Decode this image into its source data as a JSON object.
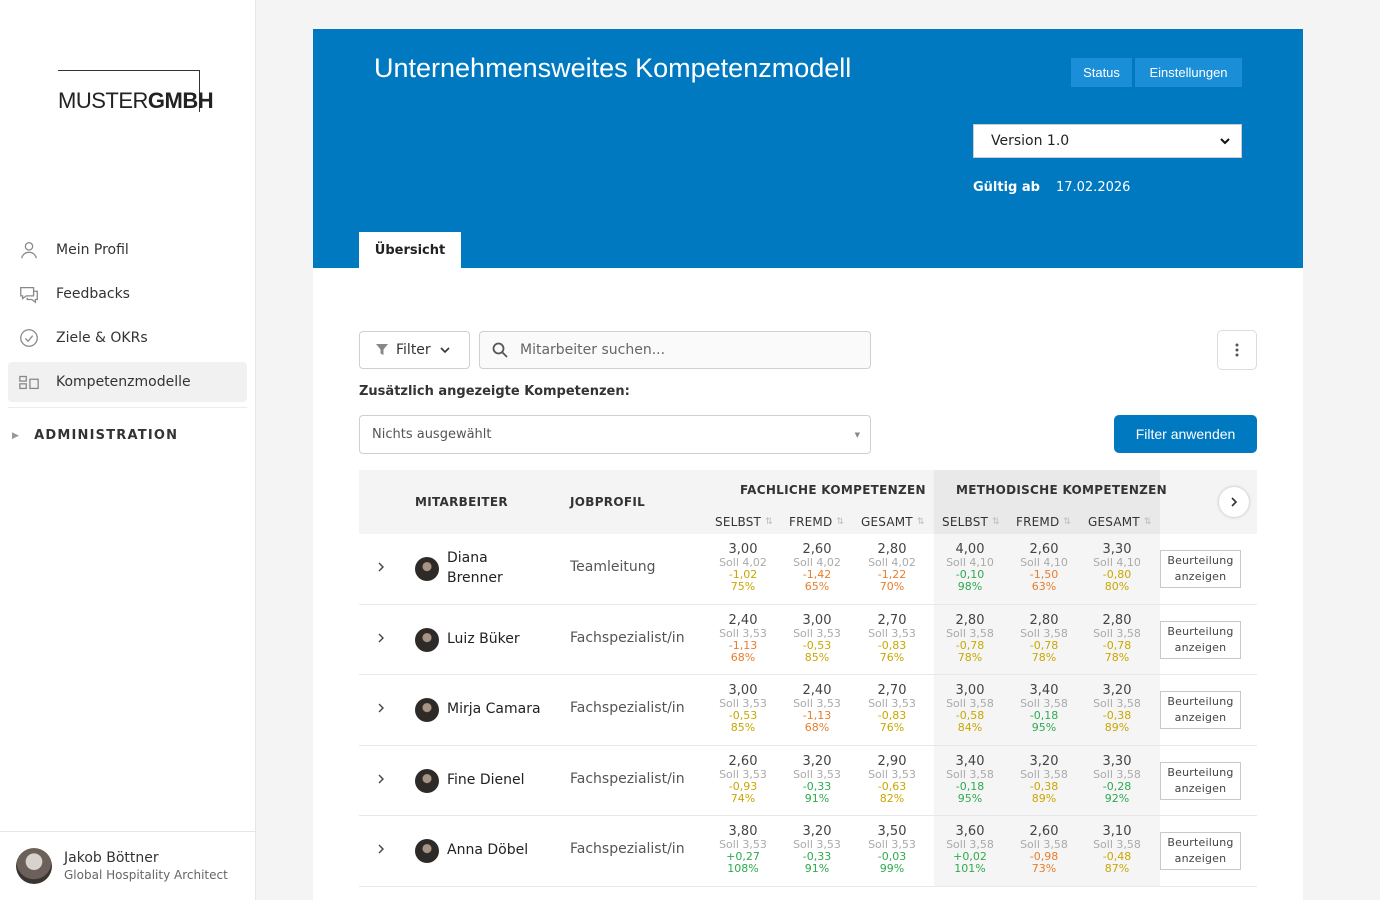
{
  "sidebar": {
    "logo": {
      "part1": "MUSTER",
      "part2": "GMBH"
    },
    "items": [
      {
        "label": "Mein Profil",
        "icon": "user-icon"
      },
      {
        "label": "Feedbacks",
        "icon": "chat-icon"
      },
      {
        "label": "Ziele & OKRs",
        "icon": "check-circle-icon"
      },
      {
        "label": "Kompetenzmodelle",
        "icon": "competence-icon",
        "active": true
      }
    ],
    "admin_label": "ADMINISTRATION",
    "user": {
      "name": "Jakob Böttner",
      "role": "Global Hospitality Architect"
    }
  },
  "header": {
    "title": "Unternehmensweites Kompetenzmodell",
    "status_label": "Status",
    "settings_label": "Einstellungen",
    "version": "Version 1.0",
    "valid_label": "Gültig ab",
    "valid_date": "17.02.2026",
    "tab": "Übersicht",
    "accent_color": "#0079c1"
  },
  "toolbar": {
    "filter_label": "Filter",
    "search_placeholder": "Mitarbeiter suchen...",
    "extra_label": "Zusätzlich angezeigte Kompetenzen:",
    "multiselect_value": "Nichts ausgewählt",
    "apply_label": "Filter anwenden"
  },
  "table": {
    "col_employee": "MITARBEITER",
    "col_job": "JOBPROFIL",
    "group_fach": "FACHLICHE KOMPETENZEN",
    "group_meth": "METHODISCHE KOMPETENZEN",
    "sub": [
      "SELBST",
      "FREMD",
      "GESAMT",
      "SELBST",
      "FREMD",
      "GESAMT"
    ],
    "eval_line1": "Beurteilung",
    "eval_line2": "anzeigen",
    "rows": [
      {
        "name1": "Diana",
        "name2": "Brenner",
        "job": "Teamleitung",
        "cells": [
          {
            "v": "3,00",
            "s": "Soll 4,02",
            "d": "-1,02",
            "p": "75%",
            "c": "neg-mid"
          },
          {
            "v": "2,60",
            "s": "Soll 4,02",
            "d": "-1,42",
            "p": "65%",
            "c": "neg-bad"
          },
          {
            "v": "2,80",
            "s": "Soll 4,02",
            "d": "-1,22",
            "p": "70%",
            "c": "neg-bad"
          },
          {
            "v": "4,00",
            "s": "Soll 4,10",
            "d": "-0,10",
            "p": "98%",
            "c": "pos"
          },
          {
            "v": "2,60",
            "s": "Soll 4,10",
            "d": "-1,50",
            "p": "63%",
            "c": "neg-bad"
          },
          {
            "v": "3,30",
            "s": "Soll 4,10",
            "d": "-0,80",
            "p": "80%",
            "c": "neg-mid"
          }
        ]
      },
      {
        "name1": "Luiz Büker",
        "name2": "",
        "job": "Fachspezialist/in",
        "cells": [
          {
            "v": "2,40",
            "s": "Soll 3,53",
            "d": "-1,13",
            "p": "68%",
            "c": "neg-bad"
          },
          {
            "v": "3,00",
            "s": "Soll 3,53",
            "d": "-0,53",
            "p": "85%",
            "c": "neg-mid"
          },
          {
            "v": "2,70",
            "s": "Soll 3,53",
            "d": "-0,83",
            "p": "76%",
            "c": "neg-mid"
          },
          {
            "v": "2,80",
            "s": "Soll 3,58",
            "d": "-0,78",
            "p": "78%",
            "c": "neg-mid"
          },
          {
            "v": "2,80",
            "s": "Soll 3,58",
            "d": "-0,78",
            "p": "78%",
            "c": "neg-mid"
          },
          {
            "v": "2,80",
            "s": "Soll 3,58",
            "d": "-0,78",
            "p": "78%",
            "c": "neg-mid"
          }
        ]
      },
      {
        "name1": "Mirja Camara",
        "name2": "",
        "job": "Fachspezialist/in",
        "cells": [
          {
            "v": "3,00",
            "s": "Soll 3,53",
            "d": "-0,53",
            "p": "85%",
            "c": "neg-mid"
          },
          {
            "v": "2,40",
            "s": "Soll 3,53",
            "d": "-1,13",
            "p": "68%",
            "c": "neg-bad"
          },
          {
            "v": "2,70",
            "s": "Soll 3,53",
            "d": "-0,83",
            "p": "76%",
            "c": "neg-mid"
          },
          {
            "v": "3,00",
            "s": "Soll 3,58",
            "d": "-0,58",
            "p": "84%",
            "c": "neg-mid"
          },
          {
            "v": "3,40",
            "s": "Soll 3,58",
            "d": "-0,18",
            "p": "95%",
            "c": "pos"
          },
          {
            "v": "3,20",
            "s": "Soll 3,58",
            "d": "-0,38",
            "p": "89%",
            "c": "neg-mid"
          }
        ]
      },
      {
        "name1": "Fine Dienel",
        "name2": "",
        "job": "Fachspezialist/in",
        "cells": [
          {
            "v": "2,60",
            "s": "Soll 3,53",
            "d": "-0,93",
            "p": "74%",
            "c": "neg-mid"
          },
          {
            "v": "3,20",
            "s": "Soll 3,53",
            "d": "-0,33",
            "p": "91%",
            "c": "pos"
          },
          {
            "v": "2,90",
            "s": "Soll 3,53",
            "d": "-0,63",
            "p": "82%",
            "c": "neg-mid"
          },
          {
            "v": "3,40",
            "s": "Soll 3,58",
            "d": "-0,18",
            "p": "95%",
            "c": "pos"
          },
          {
            "v": "3,20",
            "s": "Soll 3,58",
            "d": "-0,38",
            "p": "89%",
            "c": "neg-mid"
          },
          {
            "v": "3,30",
            "s": "Soll 3,58",
            "d": "-0,28",
            "p": "92%",
            "c": "pos"
          }
        ]
      },
      {
        "name1": "Anna Döbel",
        "name2": "",
        "job": "Fachspezialist/in",
        "cells": [
          {
            "v": "3,80",
            "s": "Soll 3,53",
            "d": "+0,27",
            "p": "108%",
            "c": "pos"
          },
          {
            "v": "3,20",
            "s": "Soll 3,53",
            "d": "-0,33",
            "p": "91%",
            "c": "pos"
          },
          {
            "v": "3,50",
            "s": "Soll 3,53",
            "d": "-0,03",
            "p": "99%",
            "c": "pos"
          },
          {
            "v": "3,60",
            "s": "Soll 3,58",
            "d": "+0,02",
            "p": "101%",
            "c": "pos"
          },
          {
            "v": "2,60",
            "s": "Soll 3,58",
            "d": "-0,98",
            "p": "73%",
            "c": "neg-bad"
          },
          {
            "v": "3,10",
            "s": "Soll 3,58",
            "d": "-0,48",
            "p": "87%",
            "c": "neg-mid"
          }
        ]
      }
    ]
  }
}
